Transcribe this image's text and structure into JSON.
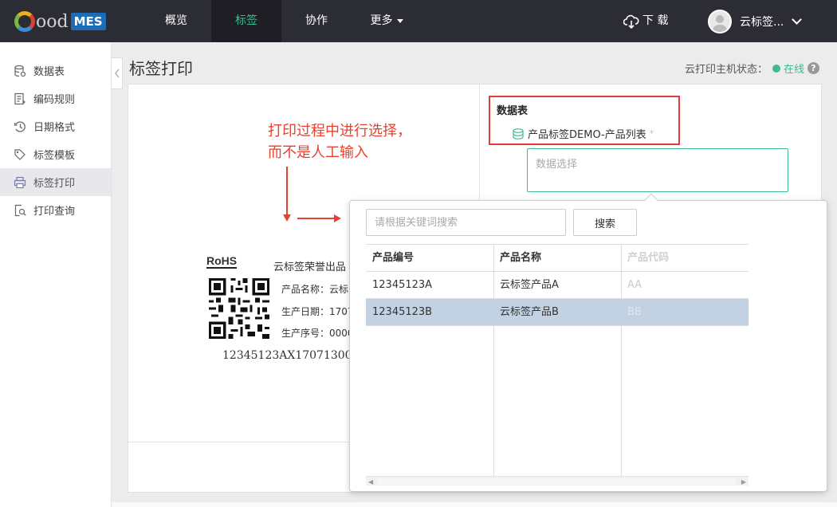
{
  "app": {
    "logo_text": "ood",
    "logo_badge": "MES",
    "nav": [
      {
        "label": "概览",
        "active": false
      },
      {
        "label": "标签",
        "active": true
      },
      {
        "label": "协作",
        "active": false
      },
      {
        "label": "更多",
        "active": false
      }
    ],
    "download_label": "下 载",
    "user_name": "云标签...",
    "accent_color": "#3fb98f"
  },
  "sidebar": {
    "items": [
      {
        "label": "数据表",
        "icon": "database-icon"
      },
      {
        "label": "编码规则",
        "icon": "rules-icon"
      },
      {
        "label": "日期格式",
        "icon": "clock-icon"
      },
      {
        "label": "标签模板",
        "icon": "tag-icon"
      },
      {
        "label": "标签打印",
        "icon": "printer-icon",
        "active": true
      },
      {
        "label": "打印查询",
        "icon": "search-doc-icon"
      }
    ]
  },
  "page": {
    "title": "标签打印",
    "status_label": "云打印主机状态：",
    "status_value": "在线",
    "help": "?"
  },
  "annotation": {
    "line1": "打印过程中进行选择，",
    "line2": "而不是人工输入"
  },
  "label_preview": {
    "rohs": "RoHS",
    "brand": "云标签荣誉出品",
    "line_name": "产品名称：云标",
    "line_date": "生产日期：1707",
    "line_seq": "生产序号：0000",
    "serial": "12345123AX17071300("
  },
  "datasource": {
    "title": "数据表",
    "item": "产品标签DEMO-产品列表",
    "required_mark": "*",
    "select_placeholder": "数据选择"
  },
  "dropdown": {
    "search_placeholder": "请根据关键词搜索",
    "search_button": "搜索",
    "columns": [
      "产品编号",
      "产品名称",
      "产品代码"
    ],
    "rows": [
      [
        "12345123A",
        "云标签产品A",
        "AA"
      ],
      [
        "12345123B",
        "云标签产品B",
        "BB"
      ]
    ],
    "selected_row": 1,
    "scroll_left": "◀",
    "scroll_right": "▶"
  }
}
